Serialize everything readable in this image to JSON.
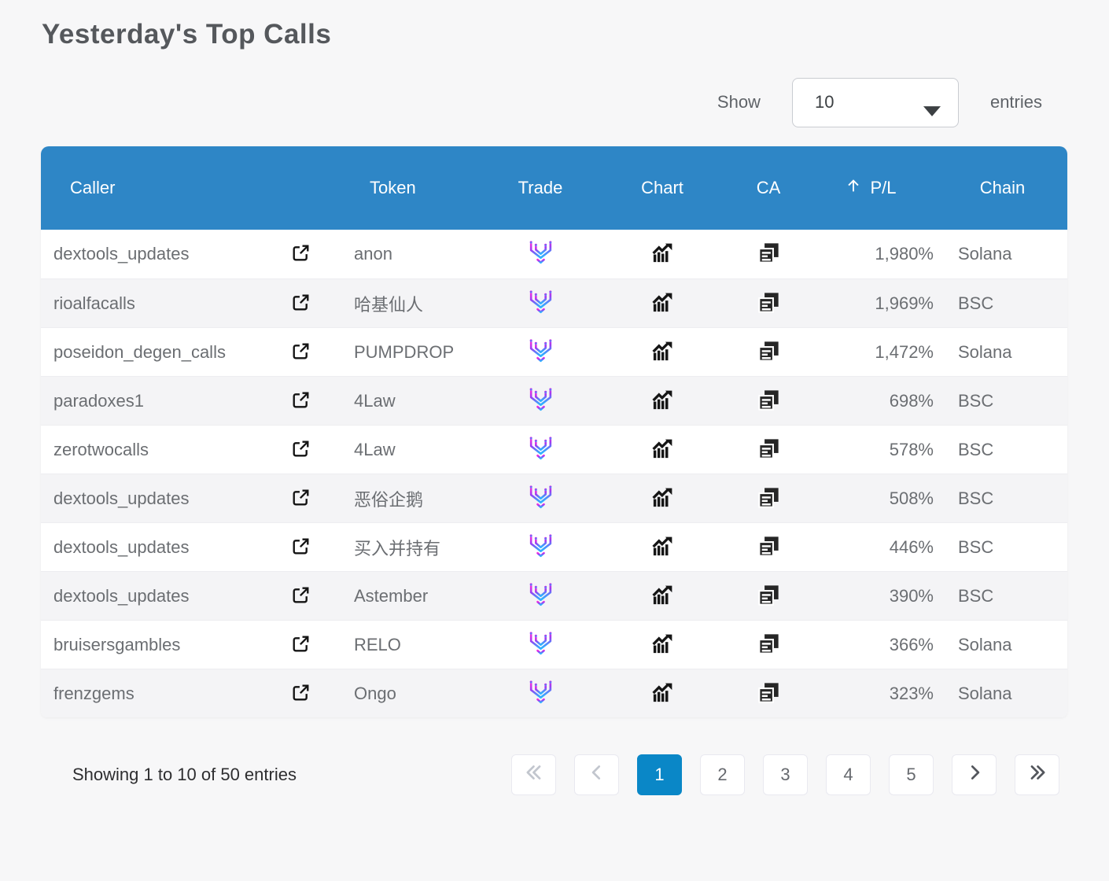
{
  "page": {
    "title": "Yesterday's Top Calls"
  },
  "controls": {
    "show_label": "Show",
    "entries_label": "entries",
    "page_size": "10",
    "dropdown_icon": "caret-down-icon"
  },
  "table": {
    "columns": {
      "caller": "Caller",
      "token": "Token",
      "trade": "Trade",
      "chart": "Chart",
      "ca": "CA",
      "pl": "P/L",
      "chain": "Chain"
    },
    "sort": {
      "column": "P/L",
      "direction": "ascending",
      "icon": "arrow-up-icon"
    },
    "icons": {
      "caller_link": "open-in-new-icon",
      "trade": "maestro-logo-icon",
      "chart": "trending-bar-chart-icon",
      "ca": "copy-contract-icon"
    },
    "rows": [
      {
        "caller": "dextools_updates",
        "token": "anon",
        "pl": "1,980%",
        "chain": "Solana"
      },
      {
        "caller": "rioalfacalls",
        "token": "哈基仙人",
        "pl": "1,969%",
        "chain": "BSC"
      },
      {
        "caller": "poseidon_degen_calls",
        "token": "PUMPDROP",
        "pl": "1,472%",
        "chain": "Solana"
      },
      {
        "caller": "paradoxes1",
        "token": "4Law",
        "pl": "698%",
        "chain": "BSC"
      },
      {
        "caller": "zerotwocalls",
        "token": "4Law",
        "pl": "578%",
        "chain": "BSC"
      },
      {
        "caller": "dextools_updates",
        "token": "恶俗企鹅",
        "pl": "508%",
        "chain": "BSC"
      },
      {
        "caller": "dextools_updates",
        "token": "买入并持有",
        "pl": "446%",
        "chain": "BSC"
      },
      {
        "caller": "dextools_updates",
        "token": "Astember",
        "pl": "390%",
        "chain": "BSC"
      },
      {
        "caller": "bruisersgambles",
        "token": "RELO",
        "pl": "366%",
        "chain": "Solana"
      },
      {
        "caller": "frenzgems",
        "token": "Ongo",
        "pl": "323%",
        "chain": "Solana"
      }
    ]
  },
  "footer": {
    "status": "Showing 1 to 10 of 50 entries",
    "pages": [
      "1",
      "2",
      "3",
      "4",
      "5"
    ],
    "active_page": "1",
    "nav_icons": [
      "first-page-icon",
      "prev-page-icon",
      "next-page-icon",
      "last-page-icon"
    ]
  },
  "colors": {
    "header_blue": "#2e86c6",
    "active_page_blue": "#0a87c7",
    "row_stripe": "#f4f4f6",
    "text_gray": "#6b6e72",
    "title_gray": "#55585c",
    "maestro_gradient": [
      "#f32ee0",
      "#9b3df2",
      "#2fb1ff"
    ],
    "icon_black": "#161616"
  }
}
